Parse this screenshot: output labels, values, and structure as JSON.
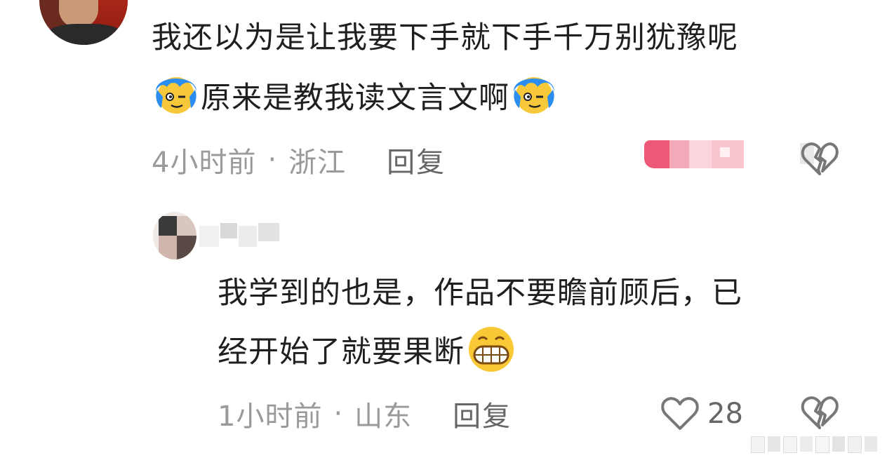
{
  "comments": [
    {
      "line1": "我还以为是让我要下手就下手千万别犹豫呢",
      "line2": "原来是教我读文言文啊",
      "time": "4小时前",
      "separator": "·",
      "location": "浙江",
      "reply_label": "回复"
    },
    {
      "line1": "我学到的也是，作品不要瞻前顾后，已",
      "line2": "经开始了就要果断",
      "time": "1小时前",
      "separator": "·",
      "location": "山东",
      "reply_label": "回复",
      "like_count": "28"
    }
  ],
  "icons": {
    "emoji_1": "blue-hair-smirk-emoji",
    "emoji_2": "grinning-emoji",
    "like": "heart-outline-icon",
    "dislike": "broken-heart-icon"
  },
  "colors": {
    "meta_text": "#9a9a9a",
    "reply_text": "#666666",
    "blur_pink": "#f2a6b8"
  }
}
